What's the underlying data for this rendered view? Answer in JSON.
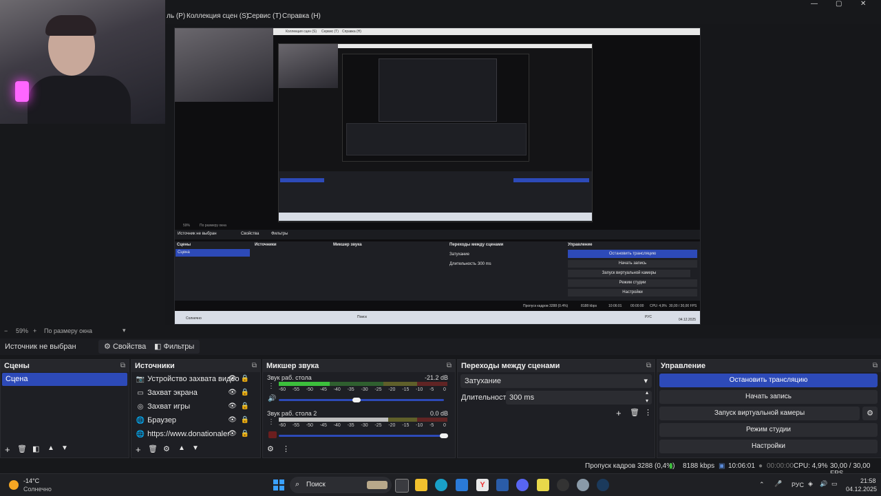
{
  "menu": {
    "partial": "ль (Р)",
    "collections": "Коллекция сцен (S)",
    "tools": "Сервис (T)",
    "help": "Справка (H)"
  },
  "window_controls": {
    "minimize": "—",
    "maximize": "▢",
    "close": "✕"
  },
  "nested_preview": {
    "menu_collections": "Коллекция сцен (S)",
    "menu_tools": "Сервис (T)",
    "menu_help": "Справка (H)",
    "zoom": "59%",
    "fit": "По размеру окна",
    "context": "Источник не выбран",
    "props": "Свойства",
    "filters": "Фильтры",
    "scenes_title": "Сцены",
    "sources_title": "Источники",
    "mixer_title": "Микшер звука",
    "transitions_title": "Переходы между сценами",
    "controls_title": "Управление",
    "scene": "Сцена",
    "stop_stream": "Остановить трансляцию",
    "start_record": "Начать запись",
    "virtual_cam": "Запуск виртуальной камеры",
    "studio": "Режим студии",
    "settings": "Настройки",
    "fade": "Затухание",
    "duration_label": "Длительность",
    "duration": "300 ms",
    "status": "Пропуск кадров 3288 (0.4%)",
    "kbps": "8188 kbps",
    "time": "10:06:01",
    "cpu": "CPU: 4,9%",
    "fps": "30,00 / 30,00 FPS",
    "search": "Поиск",
    "weather": "Солнечно",
    "date": "04.12.2025",
    "lang": "РУС",
    "rec_time": "00:00:00"
  },
  "zoombar": {
    "minus": "−",
    "zoom": "59%",
    "plus": "+",
    "fit_label": "По размеру окна"
  },
  "context": {
    "no_source": "Источник не выбран",
    "properties": "Свойства",
    "filters": "Фильтры"
  },
  "docks": {
    "scenes": {
      "title": "Сцены",
      "items": [
        "Сцена"
      ]
    },
    "sources": {
      "title": "Источники",
      "items": [
        {
          "label": "Устройство захвата видео",
          "icon": "camera-icon"
        },
        {
          "label": "Захват экрана",
          "icon": "monitor-icon"
        },
        {
          "label": "Захват игры",
          "icon": "gamepad-icon"
        },
        {
          "label": "Браузер",
          "icon": "globe-icon"
        },
        {
          "label": "https://www.donationalerts.cc",
          "icon": "globe-icon"
        }
      ]
    },
    "mixer": {
      "title": "Микшер звука",
      "channels": [
        {
          "name": "Звук раб. стола",
          "db": "-21.2 dB",
          "level": 0.47
        },
        {
          "name": "Звук раб. стола 2",
          "db": "0.0 dB",
          "level": 1.0
        }
      ],
      "ticks": [
        "-60",
        "-55",
        "-50",
        "-45",
        "-40",
        "-35",
        "-30",
        "-25",
        "-20",
        "-15",
        "-10",
        "-5",
        "0"
      ]
    },
    "transitions": {
      "title": "Переходы между сценами",
      "selected": "Затухание",
      "duration_label": "Длительность",
      "duration": "300 ms"
    },
    "controls": {
      "title": "Управление",
      "stop_stream": "Остановить трансляцию",
      "start_record": "Начать запись",
      "virtual_cam": "Запуск виртуальной камеры",
      "studio_mode": "Режим студии",
      "settings": "Настройки"
    }
  },
  "status": {
    "dropped": "Пропуск кадров 3288 (0,4%)",
    "bitrate": "8188 kbps",
    "stream_time": "10:06:01",
    "rec_time": "00:00:00",
    "cpu": "CPU: 4,9%",
    "fps": "30,00 / 30,00 FPS"
  },
  "taskbar": {
    "temp": "-14°C",
    "weather": "Солнечно",
    "search": "Поиск",
    "lang": "РУС",
    "time": "21:58",
    "date": "04.12.2025"
  },
  "colors": {
    "accent": "#2d4ab8",
    "panel": "#1e1f24",
    "bg": "#17181b",
    "meter_green": "#3cbf3c",
    "meter_yellow": "#bfbf2f",
    "meter_red": "#c03030"
  }
}
